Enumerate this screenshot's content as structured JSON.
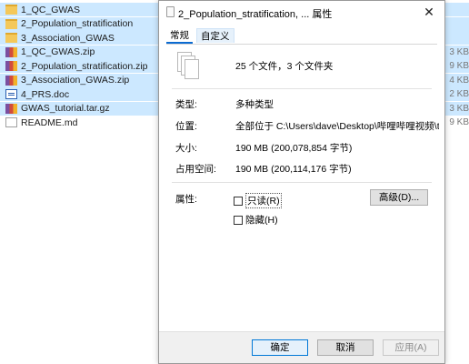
{
  "files": [
    {
      "name": "1_QC_GWAS",
      "type": "folder",
      "size": ""
    },
    {
      "name": "2_Population_stratification",
      "type": "folder",
      "size": ""
    },
    {
      "name": "3_Association_GWAS",
      "type": "folder",
      "size": ""
    },
    {
      "name": "1_QC_GWAS.zip",
      "type": "zip",
      "size": "3 KB"
    },
    {
      "name": "2_Population_stratification.zip",
      "type": "zip",
      "size": "9 KB"
    },
    {
      "name": "3_Association_GWAS.zip",
      "type": "zip",
      "size": "4 KB"
    },
    {
      "name": "4_PRS.doc",
      "type": "doc",
      "size": "2 KB"
    },
    {
      "name": "GWAS_tutorial.tar.gz",
      "type": "zip",
      "size": "3 KB"
    },
    {
      "name": "README.md",
      "type": "txt",
      "size": "9 KB"
    }
  ],
  "dialog": {
    "title": "2_Population_stratification, ... 属性",
    "close_glyph": "✕",
    "tabs": [
      {
        "label": "常规",
        "active": true
      },
      {
        "label": "自定义",
        "active": false
      }
    ],
    "summary": "25 个文件，3 个文件夹",
    "props": {
      "type_label": "类型:",
      "type_value": "多种类型",
      "location_label": "位置:",
      "location_value": "全部位于 C:\\Users\\dave\\Desktop\\哔哩哔哩视频\\test",
      "size_label": "大小:",
      "size_value": "190 MB (200,078,854 字节)",
      "disk_label": "占用空间:",
      "disk_value": "190 MB (200,114,176 字节)",
      "attr_label": "属性:",
      "readonly_label": "只读(R)",
      "hidden_label": "隐藏(H)",
      "advanced_label": "高级(D)..."
    },
    "buttons": {
      "ok": "确定",
      "cancel": "取消",
      "apply": "应用(A)"
    }
  }
}
